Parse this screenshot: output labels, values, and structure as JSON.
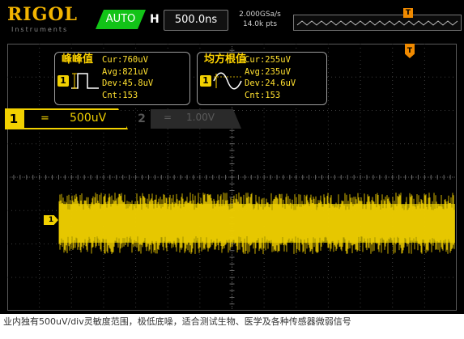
{
  "header": {
    "brand": "RIGOL",
    "brand_sub": "Instruments",
    "run_mode": "AUTO",
    "horizontal_label": "H",
    "timebase": "500.0ns",
    "sample_rate": "2.000GSa/s",
    "memory_depth": "14.0k pts",
    "trigger_marker": "T"
  },
  "measurements": [
    {
      "title": "峰峰值",
      "channel": "1",
      "cur": "Cur:760uV",
      "avg": "Avg:821uV",
      "dev": "Dev:45.8uV",
      "cnt": "Cnt:153"
    },
    {
      "title": "均方根值",
      "channel": "1",
      "cur": "Cur:255uV",
      "avg": "Avg:235uV",
      "dev": "Dev:24.6uV",
      "cnt": "Cnt:153"
    }
  ],
  "channels": {
    "ch1": {
      "number": "1",
      "coupling": "=",
      "scale": "500uV",
      "color": "#f2d100"
    },
    "ch2": {
      "number": "2",
      "coupling": "=",
      "scale": "1.00V",
      "color": "#5a5a5a"
    }
  },
  "ch1_marker": "1",
  "trigger_position_marker": "T",
  "caption": "业内独有500uV/div灵敏度范围，极低底噪，适合测试生物、医学及各种传感器微弱信号"
}
